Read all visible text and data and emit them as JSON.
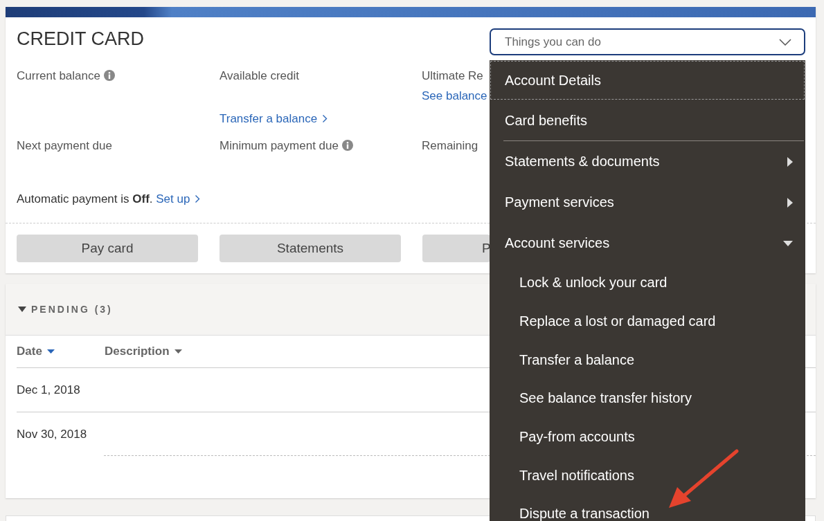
{
  "card": {
    "title": "CREDIT CARD",
    "dropdown": {
      "placeholder": "Things you can do",
      "expanded": true
    },
    "summary": [
      {
        "label": "Current balance",
        "info": true
      },
      {
        "label": "Available credit",
        "info": false,
        "links": [
          {
            "text": "Transfer a balance",
            "chevron": true
          }
        ]
      },
      {
        "label": "Ultimate Re",
        "info": false,
        "links": [
          {
            "text": "See balance",
            "chevron": false
          }
        ]
      },
      {
        "label": "Next payment due",
        "info": false
      },
      {
        "label": "Minimum payment due",
        "info": true
      },
      {
        "label": "Remaining",
        "info": false
      }
    ],
    "autopay": {
      "text": "Automatic payment is **Off**.",
      "link": "Set up"
    },
    "buttons": [
      "Pay card",
      "Statements",
      "P"
    ]
  },
  "pending": {
    "title": "PENDING (3)",
    "expanded": true,
    "columns": [
      {
        "label": "Date",
        "sorted": true
      },
      {
        "label": "Description",
        "sorted": false
      }
    ],
    "rows": [
      {
        "date": "Dec 1, 2018"
      },
      {
        "date": "Nov 30, 2018"
      }
    ]
  },
  "menu": {
    "groups": [
      [
        {
          "label": "Account Details",
          "kind": "link",
          "focused": true
        },
        {
          "label": "Card benefits",
          "kind": "link",
          "focused": false
        }
      ],
      [
        {
          "label": "Statements & documents",
          "kind": "submenu",
          "expanded": false,
          "focused": false
        },
        {
          "label": "Payment services",
          "kind": "submenu",
          "expanded": false,
          "focused": false
        },
        {
          "label": "Account services",
          "kind": "submenu",
          "expanded": true,
          "focused": false,
          "children": [
            {
              "label": "Lock & unlock your card"
            },
            {
              "label": "Replace a lost or damaged card"
            },
            {
              "label": "Transfer a balance"
            },
            {
              "label": "See balance transfer history"
            },
            {
              "label": "Pay-from accounts"
            },
            {
              "label": "Travel notifications"
            },
            {
              "label": "Dispute a transaction"
            }
          ]
        }
      ]
    ]
  }
}
